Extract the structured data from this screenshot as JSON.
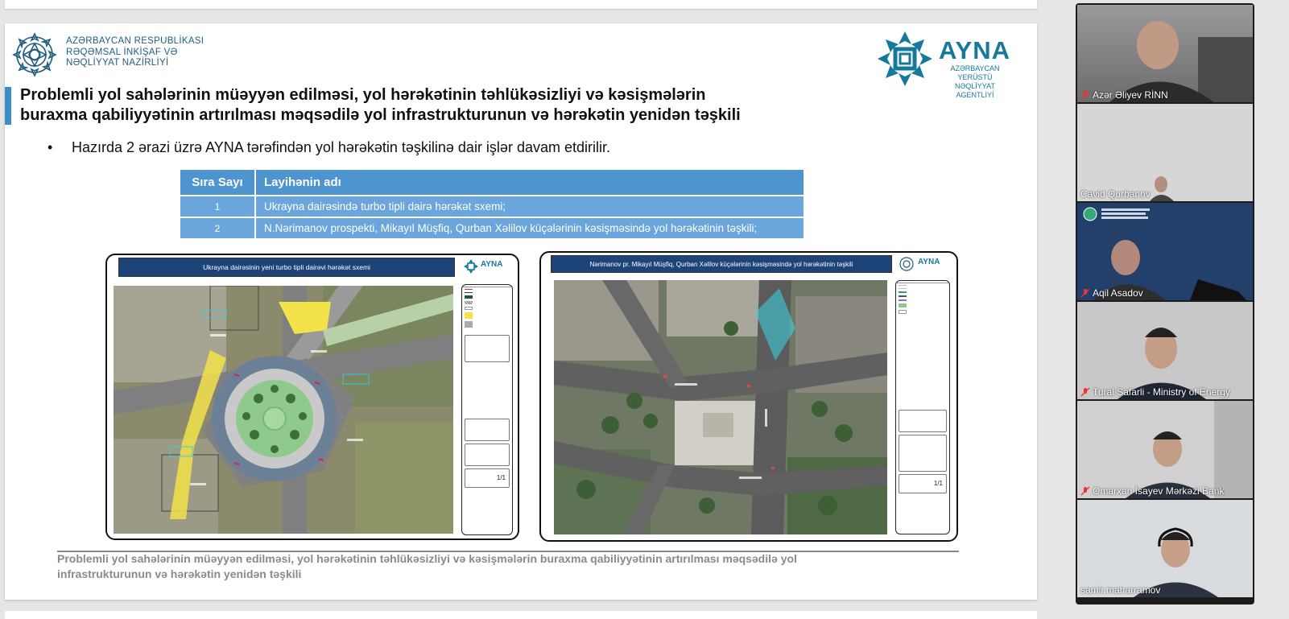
{
  "slide": {
    "ministry": {
      "line1": "AZƏRBAYCAN RESPUBLİKASI",
      "line2": "RƏQƏMSAL İNKİŞAF VƏ",
      "line3": "NƏQLİYYAT NAZİRLİYİ"
    },
    "ayna": {
      "name": "AYNA",
      "sub1": "AZƏRBAYCAN YERÜSTÜ",
      "sub2": "NƏQLİYYAT AGENTLİYİ"
    },
    "title_line1": "Problemli yol sahələrinin müəyyən edilməsi, yol hərəkətinin təhlükəsizliyi və kəsişmələrin",
    "title_line2": "buraxma qabiliyyətinin artırılması məqsədilə yol infrastrukturunun və hərəkətin yenidən təşkili",
    "bullet_symbol": "•",
    "bullet": "Hazırda 2 ərazi üzrə AYNA tərəfindən yol hərəkətin təşkilinə dair işlər davam etdirilir.",
    "table": {
      "headers": [
        "Sıra Sayı",
        "Layihənin adı"
      ],
      "rows": [
        {
          "num": "1",
          "name": "Ukrayna dairəsində turbo tipli dairə hərəkət sxemi;"
        },
        {
          "num": "2",
          "name": "N.Nərimanov prospekti, Mikayıl Müşfiq, Qurban Xəlilov küçələrinin kəsişməsində yol hərəkətinin təşkili;"
        }
      ]
    },
    "map_left": {
      "header": "Ukrayna dairəsinin yeni turbo tipli dairəvi hərəkət sxemi",
      "logo": "AYNA",
      "page": "1/1"
    },
    "map_right": {
      "header": "Nərimanov pr. Mikayıl Müşfiq, Qurban Xəlilov küçələrinin kəsişməsində yol hərəkətinin təşkili",
      "logo": "AYNA",
      "page": "1/1"
    },
    "footer_line1": "Problemli yol sahələrinin müəyyən edilməsi, yol hərəkətinin təhlükəsizliyi və kəsişmələrin buraxma qabiliyyətinin artırılması məqsədilə yol",
    "footer_line2": "infrastrukturunun və hərəkətin yenidən təşkili"
  },
  "participants": [
    {
      "name": "Azər Əliyev RİNN",
      "muted": true
    },
    {
      "name": "Cavid Qurbanov",
      "muted": false
    },
    {
      "name": "Aqil Asadov",
      "muted": true
    },
    {
      "name": "Tural Safarli - Ministry of Energy",
      "muted": true
    },
    {
      "name": "Omarxan İsayev Mərkəzi Bank",
      "muted": true
    },
    {
      "name": "samir.maharramov",
      "muted": false,
      "active": true
    }
  ],
  "colors": {
    "accent": "#3d8ec4",
    "table_header": "#4e94cf",
    "table_row": "#6aa6db",
    "brand": "#16799b",
    "active_speaker": "#3ec97a"
  }
}
